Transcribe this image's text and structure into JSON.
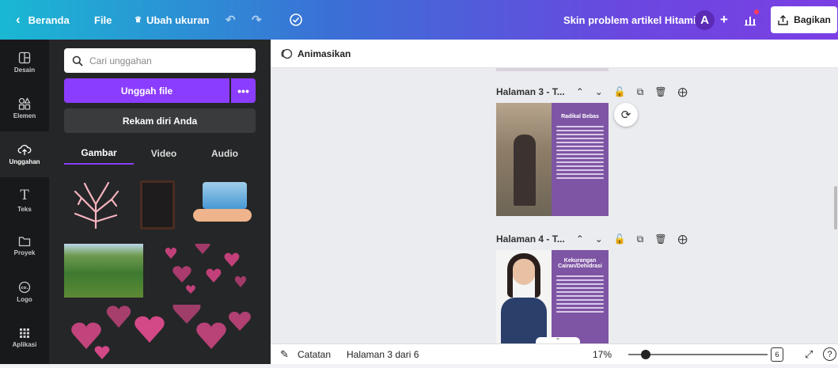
{
  "topbar": {
    "back_label": "Beranda",
    "file_label": "File",
    "resize_label": "Ubah ukuran",
    "doc_title": "Skin problem artikel Hitami",
    "avatar_letter": "A",
    "share_label": "Bagikan"
  },
  "rail": {
    "items": [
      {
        "label": "Desain",
        "icon": "layout-icon"
      },
      {
        "label": "Elemen",
        "icon": "shapes-icon"
      },
      {
        "label": "Unggahan",
        "icon": "cloud-upload-icon"
      },
      {
        "label": "Teks",
        "icon": "text-icon"
      },
      {
        "label": "Proyek",
        "icon": "folder-icon"
      },
      {
        "label": "Logo",
        "icon": "logo-icon"
      },
      {
        "label": "Aplikasi",
        "icon": "apps-grid-icon"
      }
    ]
  },
  "panel": {
    "search_placeholder": "Cari unggahan",
    "upload_label": "Unggah file",
    "more_label": "•••",
    "record_label": "Rekam diri Anda",
    "tabs": [
      "Gambar",
      "Video",
      "Audio"
    ]
  },
  "subbar": {
    "animate_label": "Animasikan"
  },
  "pages": [
    {
      "title": "Halaman 3 - T...",
      "slide_heading": "Radikal Bebas"
    },
    {
      "title": "Halaman 4 - T...",
      "slide_heading": "Kekurangan Cairan/Dehidrasi"
    }
  ],
  "bottombar": {
    "notes_label": "Catatan",
    "page_indicator": "Halaman 3 dari 6",
    "zoom": "17%",
    "page_count": "6",
    "help": "?"
  },
  "colors": {
    "accent": "#8b3dff",
    "slide_purple": "#7e55a4",
    "dark_panel": "#252627",
    "rail_bg": "#18191b"
  }
}
